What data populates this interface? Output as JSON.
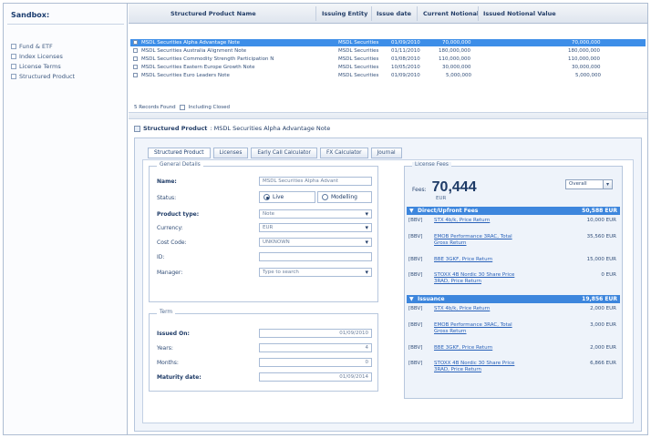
{
  "sidebar": {
    "title": "Sandbox:",
    "items": [
      {
        "label": "Fund & ETF"
      },
      {
        "label": "Index Licenses"
      },
      {
        "label": "License Terms"
      },
      {
        "label": "Structured Product"
      }
    ]
  },
  "grid": {
    "columns": [
      "Structured Product Name",
      "Issuing Entity",
      "Issue date",
      "Current Notional",
      "Issued Notional Value"
    ],
    "rows": [
      {
        "name": "MSDL Securities Alpha Advantage Note",
        "entity": "MSDL Securities",
        "date": "01/09/2010",
        "current": "70,000,000",
        "issued": "70,000,000",
        "selected": true
      },
      {
        "name": "MSDL Securities Australia Alignment Note",
        "entity": "MSDL Securities",
        "date": "01/11/2010",
        "current": "180,000,000",
        "issued": "180,000,000",
        "selected": false
      },
      {
        "name": "MSDL Securities Commodity Strength Participation N",
        "entity": "MSDL Securities",
        "date": "01/08/2010",
        "current": "110,000,000",
        "issued": "110,000,000",
        "selected": false
      },
      {
        "name": "MSDL Securities Eastern Europe Growth Note",
        "entity": "MSDL Securities",
        "date": "10/05/2010",
        "current": "30,000,000",
        "issued": "30,000,000",
        "selected": false
      },
      {
        "name": "MSDL Securities Euro Leaders Note",
        "entity": "MSDL Securities",
        "date": "01/09/2010",
        "current": "5,000,000",
        "issued": "5,000,000",
        "selected": false
      }
    ],
    "records_text": "5 Records Found",
    "include_closed": "Including Closed"
  },
  "detail": {
    "title_prefix": "Structured Product",
    "title_name": ": MSDL Securities Alpha Advantage Note",
    "tabs": [
      "Structured Product",
      "Licenses",
      "Early Call Calculator",
      "FX Calculator",
      "Journal"
    ],
    "general": {
      "legend": "General Details",
      "name_label": "Name:",
      "name_value": "MSDL Securities Alpha Advant",
      "status_label": "Status:",
      "status_live": "Live",
      "status_modelling": "Modelling",
      "type_label": "Product type:",
      "type_value": "Note",
      "currency_label": "Currency:",
      "currency_value": "EUR",
      "cost_label": "Cost Code:",
      "cost_value": "UNKNOWN",
      "id_label": "ID:",
      "id_value": "",
      "manager_label": "Manager:",
      "manager_value": "Type to search"
    },
    "term": {
      "legend": "Term",
      "issued_label": "Issued On:",
      "issued_value": "01/09/2010",
      "years_label": "Years:",
      "years_value": "4",
      "months_label": "Months:",
      "months_value": "0",
      "maturity_label": "Maturity date:",
      "maturity_value": "01/09/2014"
    },
    "fees": {
      "legend": "License Fees",
      "total_label": "Fees:",
      "total_value": "70,444",
      "unit": "EUR",
      "select_value": "Overall",
      "groups": [
        {
          "name": "Direct/Upfront Fees",
          "amount": "50,588 EUR",
          "items": [
            {
              "code": "[BBV]",
              "name": "STX 4b/k, Price Return",
              "amount": "10,000 EUR"
            },
            {
              "code": "[BBV]",
              "name": "EMOB Performance 3RAC, Total Gross Return",
              "amount": "35,560 EUR"
            },
            {
              "code": "[BBV]",
              "name": "BBE 3GKF, Price Return",
              "amount": "15,000 EUR"
            },
            {
              "code": "[BBV]",
              "name": "STOXX 4B Nordic 30 Share Price 3RAD, Price Return",
              "amount": "0 EUR"
            }
          ]
        },
        {
          "name": "Issuance",
          "amount": "19,856 EUR",
          "items": [
            {
              "code": "[BBV]",
              "name": "STX 4b/k, Price Return",
              "amount": "2,000 EUR"
            },
            {
              "code": "[BBV]",
              "name": "EMOB Performance 3RAC, Total Gross Return",
              "amount": "3,000 EUR"
            },
            {
              "code": "[BBV]",
              "name": "BBE 3GKF, Price Return",
              "amount": "2,000 EUR"
            },
            {
              "code": "[BBV]",
              "name": "STOXX 4B Nordic 30 Share Price 3RAD, Price Return",
              "amount": "6,866 EUR"
            }
          ]
        }
      ]
    }
  }
}
